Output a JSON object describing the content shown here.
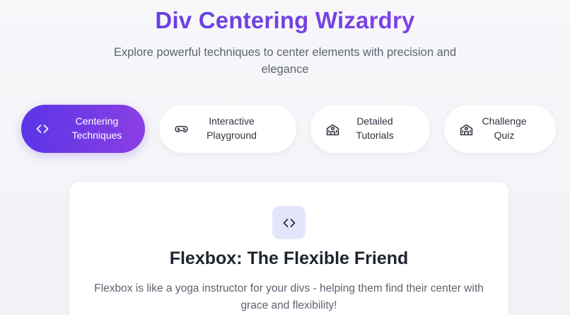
{
  "header": {
    "title": "Div Centering Wizardry",
    "subtitle": "Explore powerful techniques to center elements with precision and elegance"
  },
  "tabs": [
    {
      "label_line1": "Centering",
      "label_line2": "Techniques",
      "icon": "code-brackets-icon",
      "active": true
    },
    {
      "label_line1": "Interactive",
      "label_line2": "Playground",
      "icon": "gamepad-icon",
      "active": false
    },
    {
      "label_line1": "Detailed",
      "label_line2": "Tutorials",
      "icon": "school-icon",
      "active": false
    },
    {
      "label_line1": "Challenge",
      "label_line2": "Quiz",
      "icon": "school-icon",
      "active": false
    }
  ],
  "card": {
    "icon": "code-brackets-icon",
    "title": "Flexbox: The Flexible Friend",
    "description": "Flexbox is like a yoga instructor for your divs - helping them find their center with grace and flexibility!"
  },
  "colors": {
    "accent_start": "#5a35e6",
    "accent_end": "#8a3fe4",
    "text_dark": "#1f2530",
    "text_muted": "#5c6370",
    "icon_bg": "#e3e6fb"
  }
}
